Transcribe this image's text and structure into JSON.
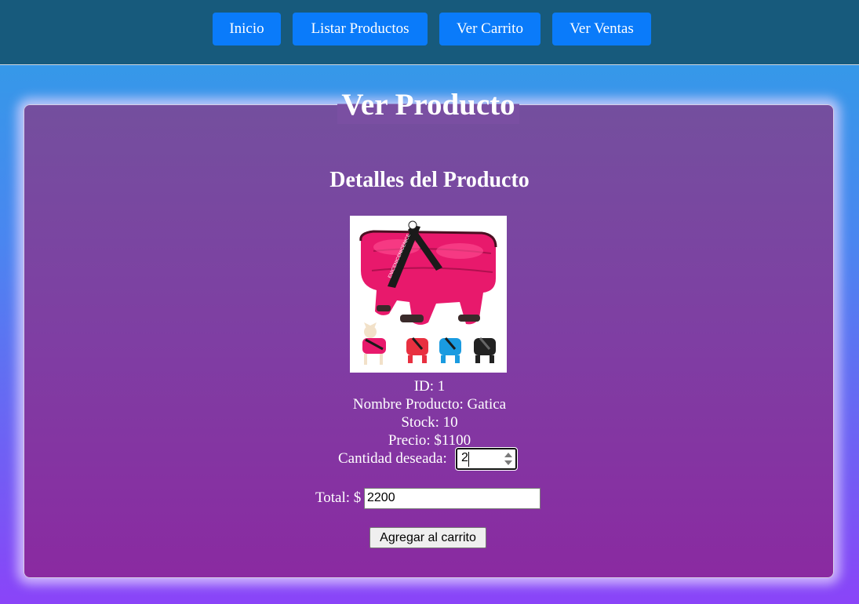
{
  "nav": {
    "items": [
      {
        "label": "Inicio"
      },
      {
        "label": "Listar Productos"
      },
      {
        "label": "Ver Carrito"
      },
      {
        "label": "Ver Ventas"
      }
    ]
  },
  "page": {
    "title": "Ver Producto",
    "subtitle": "Detalles del Producto"
  },
  "product": {
    "image_icon": "pink-dog-jacket-product-image",
    "image_strap_text": "ENICENICENICENICE",
    "id_line": "ID: 1",
    "name_line": "Nombre Producto: Gatica",
    "stock_line": "Stock: 10",
    "price_line": "Precio: $1100"
  },
  "form": {
    "quantity_label": "Cantidad deseada:",
    "quantity_value": "2",
    "total_label": "Total: $",
    "total_value": "2200",
    "add_button_label": "Agregar al carrito"
  },
  "colors": {
    "nav_button": "#0a7bfa",
    "topbar": "#175a7c",
    "jacket": "#e8196c"
  }
}
